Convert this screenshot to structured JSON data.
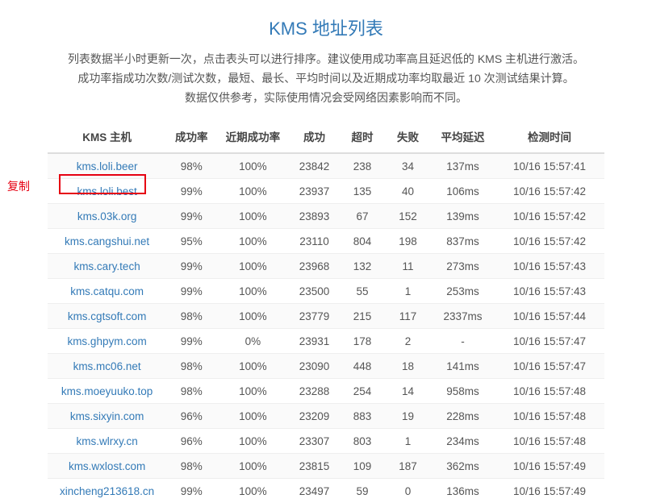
{
  "title": "KMS 地址列表",
  "description_lines": [
    "列表数据半小时更新一次，点击表头可以进行排序。建议使用成功率高且延迟低的 KMS 主机进行激活。",
    "成功率指成功次数/测试次数，最短、最长、平均时间以及近期成功率均取最近 10 次测试结果计算。",
    "数据仅供参考，实际使用情况会受网络因素影响而不同。"
  ],
  "copy_label": "复制",
  "highlighted_row_index": 1,
  "columns": [
    "KMS 主机",
    "成功率",
    "近期成功率",
    "成功",
    "超时",
    "失败",
    "平均延迟",
    "检测时间"
  ],
  "rows": [
    {
      "host": "kms.loli.beer",
      "rate": "98%",
      "recent": "100%",
      "ok": "23842",
      "timeout": "238",
      "fail": "34",
      "latency": "137ms",
      "time": "10/16 15:57:41"
    },
    {
      "host": "kms.loli.best",
      "rate": "99%",
      "recent": "100%",
      "ok": "23937",
      "timeout": "135",
      "fail": "40",
      "latency": "106ms",
      "time": "10/16 15:57:42"
    },
    {
      "host": "kms.03k.org",
      "rate": "99%",
      "recent": "100%",
      "ok": "23893",
      "timeout": "67",
      "fail": "152",
      "latency": "139ms",
      "time": "10/16 15:57:42"
    },
    {
      "host": "kms.cangshui.net",
      "rate": "95%",
      "recent": "100%",
      "ok": "23110",
      "timeout": "804",
      "fail": "198",
      "latency": "837ms",
      "time": "10/16 15:57:42"
    },
    {
      "host": "kms.cary.tech",
      "rate": "99%",
      "recent": "100%",
      "ok": "23968",
      "timeout": "132",
      "fail": "11",
      "latency": "273ms",
      "time": "10/16 15:57:43"
    },
    {
      "host": "kms.catqu.com",
      "rate": "99%",
      "recent": "100%",
      "ok": "23500",
      "timeout": "55",
      "fail": "1",
      "latency": "253ms",
      "time": "10/16 15:57:43"
    },
    {
      "host": "kms.cgtsoft.com",
      "rate": "98%",
      "recent": "100%",
      "ok": "23779",
      "timeout": "215",
      "fail": "117",
      "latency": "2337ms",
      "time": "10/16 15:57:44"
    },
    {
      "host": "kms.ghpym.com",
      "rate": "99%",
      "recent": "0%",
      "ok": "23931",
      "timeout": "178",
      "fail": "2",
      "latency": "-",
      "time": "10/16 15:57:47"
    },
    {
      "host": "kms.mc06.net",
      "rate": "98%",
      "recent": "100%",
      "ok": "23090",
      "timeout": "448",
      "fail": "18",
      "latency": "141ms",
      "time": "10/16 15:57:47"
    },
    {
      "host": "kms.moeyuuko.top",
      "rate": "98%",
      "recent": "100%",
      "ok": "23288",
      "timeout": "254",
      "fail": "14",
      "latency": "958ms",
      "time": "10/16 15:57:48"
    },
    {
      "host": "kms.sixyin.com",
      "rate": "96%",
      "recent": "100%",
      "ok": "23209",
      "timeout": "883",
      "fail": "19",
      "latency": "228ms",
      "time": "10/16 15:57:48"
    },
    {
      "host": "kms.wlrxy.cn",
      "rate": "96%",
      "recent": "100%",
      "ok": "23307",
      "timeout": "803",
      "fail": "1",
      "latency": "234ms",
      "time": "10/16 15:57:48"
    },
    {
      "host": "kms.wxlost.com",
      "rate": "98%",
      "recent": "100%",
      "ok": "23815",
      "timeout": "109",
      "fail": "187",
      "latency": "362ms",
      "time": "10/16 15:57:49"
    },
    {
      "host": "xincheng213618.cn",
      "rate": "99%",
      "recent": "100%",
      "ok": "23497",
      "timeout": "59",
      "fail": "0",
      "latency": "136ms",
      "time": "10/16 15:57:49"
    }
  ]
}
